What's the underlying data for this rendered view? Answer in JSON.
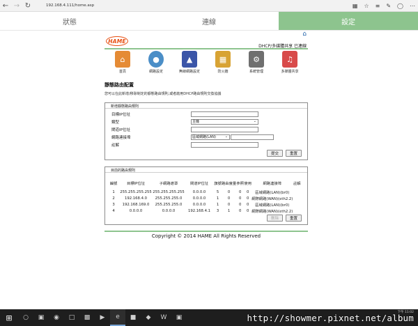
{
  "browser": {
    "address": "192.168.4.111/home.asp",
    "icons": [
      "back-icon",
      "forward-icon",
      "refresh-icon",
      "reading-view-icon",
      "favorite-star-icon",
      "hub-icon",
      "note-icon",
      "share-icon",
      "more-icon"
    ]
  },
  "tabs": [
    {
      "label": "狀態",
      "active": false
    },
    {
      "label": "連線",
      "active": false
    },
    {
      "label": "設定",
      "active": true
    }
  ],
  "header": {
    "logo_text": "HAME",
    "status": "DHCP/多媒體共享   已連線"
  },
  "menu": [
    {
      "label": "首頁",
      "icon": "home-icon",
      "color": "#e58b35"
    },
    {
      "label": "網路設定",
      "icon": "globe-icon",
      "color": "#4b8ec7"
    },
    {
      "label": "無線網路設定",
      "icon": "wifi-icon",
      "color": "#3b55a8"
    },
    {
      "label": "防火牆",
      "icon": "firewall-icon",
      "color": "#d8a334"
    },
    {
      "label": "系統管理",
      "icon": "admin-icon",
      "color": "#6f6f6f"
    },
    {
      "label": "多媒體共享",
      "icon": "media-share-icon",
      "color": "#d84a4a"
    }
  ],
  "page": {
    "title": "靜態路由配置",
    "description": "您可以在此新增/移除制定的靜態路由規則,或者啟用DHCP路由規則交換協議"
  },
  "add_form": {
    "heading": "新增靜態路由規則",
    "fields": {
      "dest_ip": {
        "label": "目標IP位址",
        "value": ""
      },
      "type": {
        "label": "類型",
        "value": "主機"
      },
      "gateway": {
        "label": "閘道IP位址",
        "value": ""
      },
      "interface": {
        "label": "網路連接埠",
        "value": "區域網路(LAN)",
        "extra": ""
      },
      "comment": {
        "label": "註解",
        "value": ""
      }
    },
    "submit_label": "提交",
    "reset_label": "重置"
  },
  "route_table": {
    "heading": "目前的路由規則",
    "columns": [
      "編號",
      "目標IP位址",
      "子網路遮罩",
      "閘道IP位址",
      "旗號",
      "路由度量",
      "參照",
      "使用",
      "網路連接埠",
      "註解"
    ],
    "rows": [
      [
        "1",
        "255.255.255.255",
        "255.255.255.255",
        "0.0.0.0",
        "5",
        "0",
        "0",
        "0",
        "區域網路(LAN)(br0)",
        ""
      ],
      [
        "2",
        "192.168.4.0",
        "255.255.255.0",
        "0.0.0.0",
        "1",
        "0",
        "0",
        "0",
        "網際網路(WAN)(eth2.2)",
        ""
      ],
      [
        "3",
        "192.168.169.0",
        "255.255.255.0",
        "0.0.0.0",
        "1",
        "0",
        "0",
        "0",
        "區域網路(LAN)(br0)",
        ""
      ],
      [
        "4",
        "0.0.0.0",
        "0.0.0.0",
        "192.168.4.1",
        "3",
        "1",
        "0",
        "0",
        "網際網路(WAN)(eth2.2)",
        ""
      ]
    ],
    "delete_label": "刪除",
    "reset_label": "重置"
  },
  "footer": {
    "copyright": "Copyright © 2014 HAME All Rights Reserved"
  },
  "taskbar": {
    "watermark": "http://showmer.pixnet.net/album",
    "clock": "下午 11:02"
  }
}
